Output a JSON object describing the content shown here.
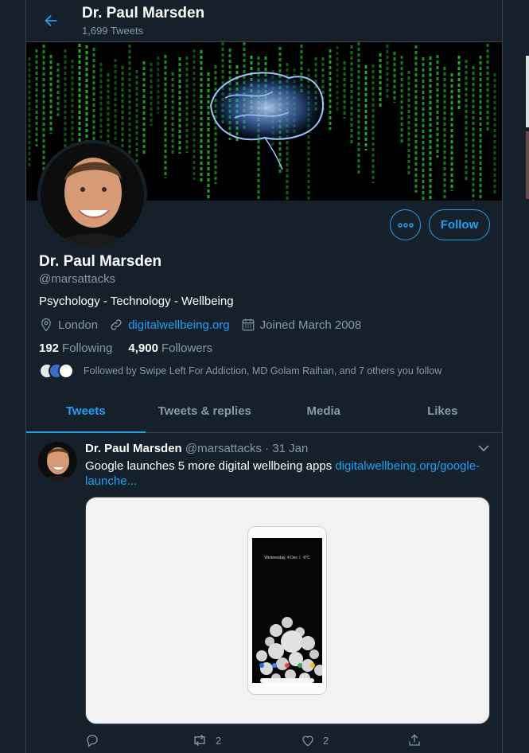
{
  "header": {
    "title": "Dr. Paul Marsden",
    "tweet_count": "1,699 Tweets"
  },
  "profile": {
    "name": "Dr. Paul Marsden",
    "handle": "@marsattacks",
    "bio": "Psychology - Technology - Wellbeing",
    "location": "London",
    "website": "digitalwellbeing.org",
    "joined": "Joined March 2008",
    "following_count": "192",
    "following_label": "Following",
    "followers_count": "4,900",
    "followers_label": "Followers",
    "followed_by": "Followed by Swipe Left For Addiction, MD Golam Raihan, and 7 others you follow",
    "follow_button": "Follow"
  },
  "tabs": [
    {
      "label": "Tweets",
      "active": true
    },
    {
      "label": "Tweets & replies",
      "active": false
    },
    {
      "label": "Media",
      "active": false
    },
    {
      "label": "Likes",
      "active": false
    }
  ],
  "tweet": {
    "author": "Dr. Paul Marsden",
    "handle": "@marsattacks",
    "sep": "·",
    "date": "31 Jan",
    "text": "Google launches 5 more digital wellbeing apps ",
    "link": "digitalwellbeing.org/google-launche...",
    "media": {
      "phone_status": "Wednesday, 4 Dec ☾ 6°C"
    },
    "replies": "",
    "retweets": "2",
    "likes": "2"
  },
  "colors": {
    "background": "#15202b",
    "accent": "#1da1f2",
    "muted": "#8899a6",
    "border": "#38444d"
  },
  "icons": [
    "back-arrow-icon",
    "more-icon",
    "location-icon",
    "link-icon",
    "calendar-icon",
    "chevron-down-icon",
    "reply-icon",
    "retweet-icon",
    "like-icon",
    "share-icon"
  ]
}
